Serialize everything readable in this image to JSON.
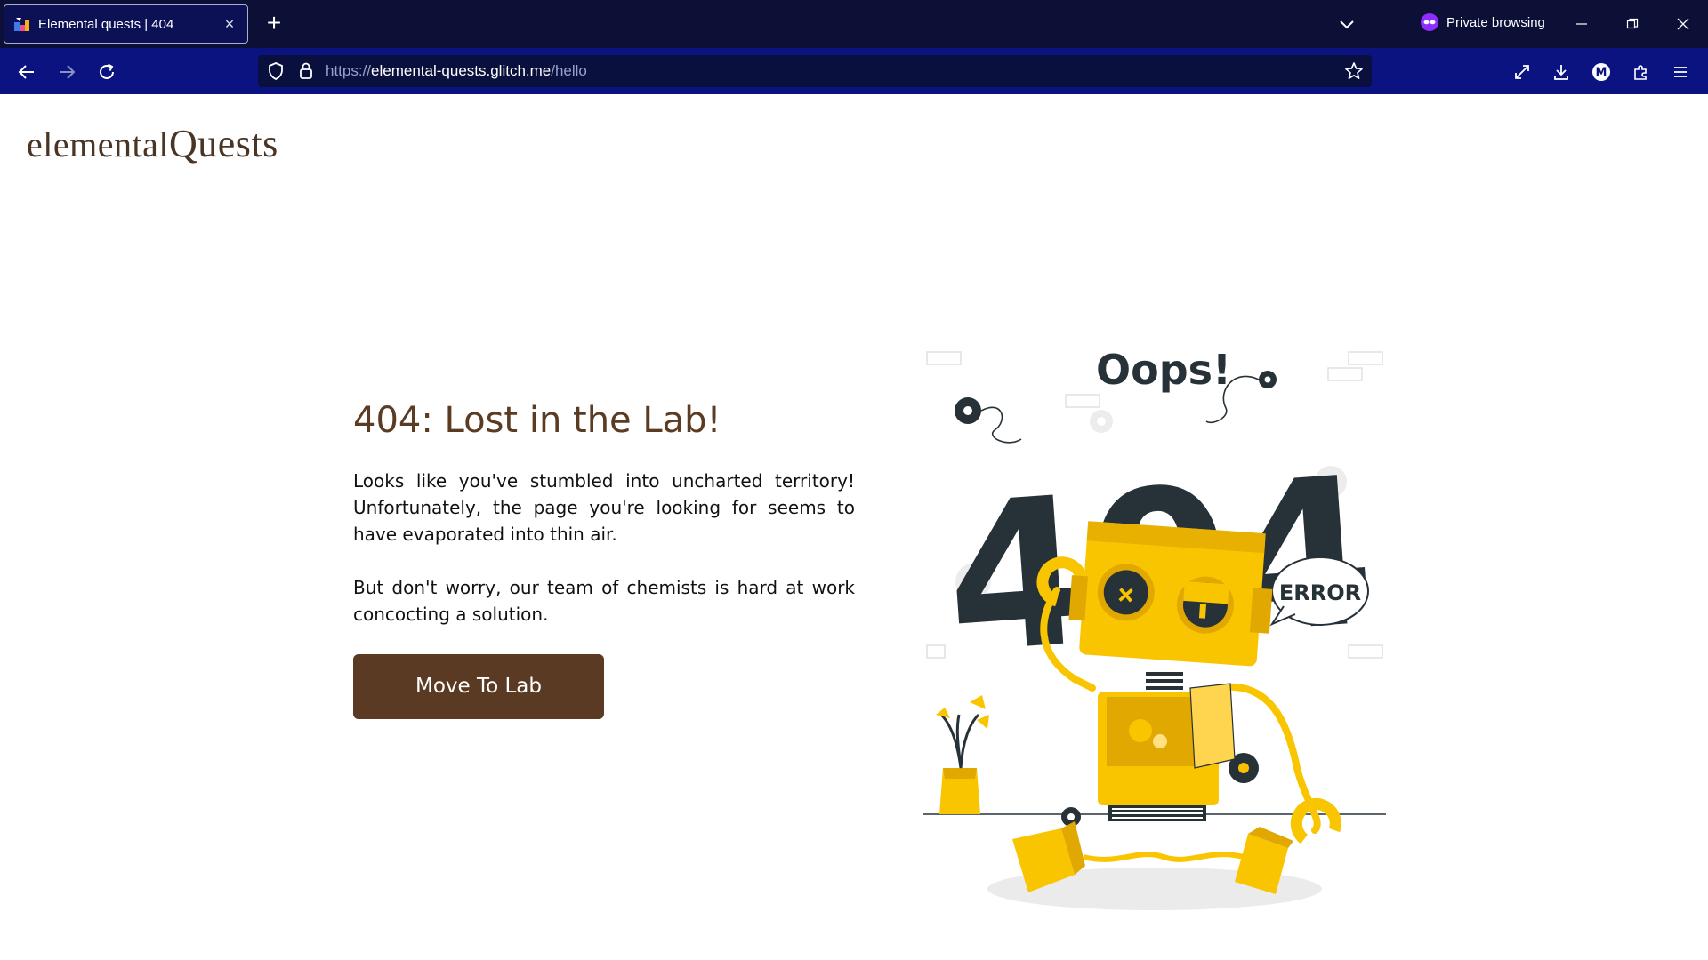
{
  "browser": {
    "tab": {
      "title": "Elemental quests | 404",
      "close": "×"
    },
    "new_tab": "+",
    "private_label": "Private browsing",
    "address": {
      "scheme": "https://",
      "host": "elemental-quests.glitch.me",
      "path": "/hello"
    },
    "account_initial": "M"
  },
  "page": {
    "logo": {
      "part1": "elemental",
      "part2": "Quests"
    },
    "heading": "404: Lost in the Lab!",
    "paragraph1": "Looks like you've stumbled into uncharted territory! Unfortunately, the page you're looking for seems to have evaporated into thin air.",
    "paragraph2": "But don't worry, our team of chemists is hard at work concocting a solution.",
    "button": "Move To Lab"
  },
  "illustration": {
    "title": "Oops!",
    "code": "404",
    "bubble": "ERROR"
  },
  "colors": {
    "accent_brown": "#5a3a22",
    "robot_yellow": "#f9c400",
    "dark": "#263238"
  }
}
